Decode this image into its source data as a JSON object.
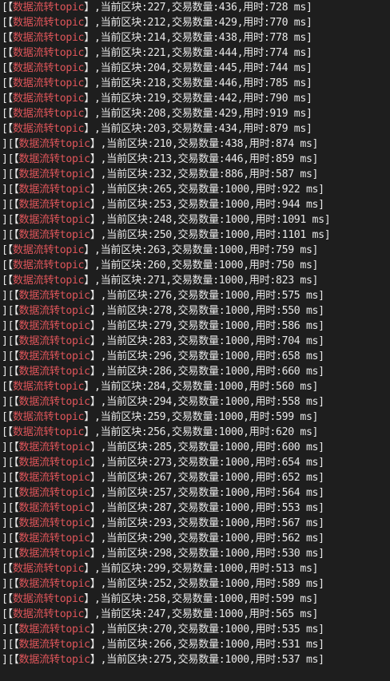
{
  "terminal": {
    "colors": {
      "background": "#1e1e1e",
      "text": "#e8e8e8",
      "topic": "#e0555a"
    },
    "lines": [
      {
        "prefix": "[【",
        "topic": "数据流转topic",
        "suffix": "】,当前区块:227,交易数量:436,用时:728 ms]"
      },
      {
        "prefix": "[【",
        "topic": "数据流转topic",
        "suffix": "】,当前区块:212,交易数量:429,用时:770 ms]"
      },
      {
        "prefix": "[【",
        "topic": "数据流转topic",
        "suffix": "】,当前区块:214,交易数量:438,用时:778 ms]"
      },
      {
        "prefix": "[【",
        "topic": "数据流转topic",
        "suffix": "】,当前区块:221,交易数量:444,用时:774 ms]"
      },
      {
        "prefix": "[【",
        "topic": "数据流转topic",
        "suffix": "】,当前区块:204,交易数量:445,用时:744 ms]"
      },
      {
        "prefix": "[【",
        "topic": "数据流转topic",
        "suffix": "】,当前区块:218,交易数量:446,用时:785 ms]"
      },
      {
        "prefix": "[【",
        "topic": "数据流转topic",
        "suffix": "】,当前区块:219,交易数量:442,用时:790 ms]"
      },
      {
        "prefix": "[【",
        "topic": "数据流转topic",
        "suffix": "】,当前区块:208,交易数量:429,用时:919 ms]"
      },
      {
        "prefix": "[【",
        "topic": "数据流转topic",
        "suffix": "】,当前区块:203,交易数量:434,用时:879 ms]"
      },
      {
        "prefix": "][【",
        "topic": "数据流转topic",
        "suffix": "】,当前区块:210,交易数量:438,用时:874 ms]"
      },
      {
        "prefix": "][【",
        "topic": "数据流转topic",
        "suffix": "】,当前区块:213,交易数量:446,用时:859 ms]"
      },
      {
        "prefix": "][【",
        "topic": "数据流转topic",
        "suffix": "】,当前区块:232,交易数量:886,用时:587 ms]"
      },
      {
        "prefix": "][【",
        "topic": "数据流转topic",
        "suffix": "】,当前区块:265,交易数量:1000,用时:922 ms]"
      },
      {
        "prefix": "][【",
        "topic": "数据流转topic",
        "suffix": "】,当前区块:253,交易数量:1000,用时:944 ms]"
      },
      {
        "prefix": "][【",
        "topic": "数据流转topic",
        "suffix": "】,当前区块:248,交易数量:1000,用时:1091 ms]"
      },
      {
        "prefix": "][【",
        "topic": "数据流转topic",
        "suffix": "】,当前区块:250,交易数量:1000,用时:1101 ms]"
      },
      {
        "prefix": "[【",
        "topic": "数据流转topic",
        "suffix": "】,当前区块:263,交易数量:1000,用时:759 ms]"
      },
      {
        "prefix": "[【",
        "topic": "数据流转topic",
        "suffix": "】,当前区块:260,交易数量:1000,用时:750 ms]"
      },
      {
        "prefix": "[【",
        "topic": "数据流转topic",
        "suffix": "】,当前区块:271,交易数量:1000,用时:823 ms]"
      },
      {
        "prefix": "][【",
        "topic": "数据流转topic",
        "suffix": "】,当前区块:276,交易数量:1000,用时:575 ms]"
      },
      {
        "prefix": "][【",
        "topic": "数据流转topic",
        "suffix": "】,当前区块:278,交易数量:1000,用时:550 ms]"
      },
      {
        "prefix": "][【",
        "topic": "数据流转topic",
        "suffix": "】,当前区块:279,交易数量:1000,用时:586 ms]"
      },
      {
        "prefix": "][【",
        "topic": "数据流转topic",
        "suffix": "】,当前区块:283,交易数量:1000,用时:704 ms]"
      },
      {
        "prefix": "][【",
        "topic": "数据流转topic",
        "suffix": "】,当前区块:296,交易数量:1000,用时:658 ms]"
      },
      {
        "prefix": "][【",
        "topic": "数据流转topic",
        "suffix": "】,当前区块:286,交易数量:1000,用时:660 ms]"
      },
      {
        "prefix": "[【",
        "topic": "数据流转topic",
        "suffix": "】,当前区块:284,交易数量:1000,用时:560 ms]"
      },
      {
        "prefix": "][【",
        "topic": "数据流转topic",
        "suffix": "】,当前区块:294,交易数量:1000,用时:558 ms]"
      },
      {
        "prefix": "[【",
        "topic": "数据流转topic",
        "suffix": "】,当前区块:259,交易数量:1000,用时:599 ms]"
      },
      {
        "prefix": "[【",
        "topic": "数据流转topic",
        "suffix": "】,当前区块:256,交易数量:1000,用时:620 ms]"
      },
      {
        "prefix": "][【",
        "topic": "数据流转topic",
        "suffix": "】,当前区块:285,交易数量:1000,用时:600 ms]"
      },
      {
        "prefix": "][【",
        "topic": "数据流转topic",
        "suffix": "】,当前区块:273,交易数量:1000,用时:654 ms]"
      },
      {
        "prefix": "][【",
        "topic": "数据流转topic",
        "suffix": "】,当前区块:267,交易数量:1000,用时:652 ms]"
      },
      {
        "prefix": "][【",
        "topic": "数据流转topic",
        "suffix": "】,当前区块:257,交易数量:1000,用时:564 ms]"
      },
      {
        "prefix": "][【",
        "topic": "数据流转topic",
        "suffix": "】,当前区块:287,交易数量:1000,用时:553 ms]"
      },
      {
        "prefix": "][【",
        "topic": "数据流转topic",
        "suffix": "】,当前区块:293,交易数量:1000,用时:567 ms]"
      },
      {
        "prefix": "][【",
        "topic": "数据流转topic",
        "suffix": "】,当前区块:290,交易数量:1000,用时:562 ms]"
      },
      {
        "prefix": "][【",
        "topic": "数据流转topic",
        "suffix": "】,当前区块:298,交易数量:1000,用时:530 ms]"
      },
      {
        "prefix": "[【",
        "topic": "数据流转topic",
        "suffix": "】,当前区块:299,交易数量:1000,用时:513 ms]"
      },
      {
        "prefix": "][【",
        "topic": "数据流转topic",
        "suffix": "】,当前区块:252,交易数量:1000,用时:589 ms]"
      },
      {
        "prefix": "[【",
        "topic": "数据流转topic",
        "suffix": "】,当前区块:258,交易数量:1000,用时:599 ms]"
      },
      {
        "prefix": "[【",
        "topic": "数据流转topic",
        "suffix": "】,当前区块:247,交易数量:1000,用时:565 ms]"
      },
      {
        "prefix": "][【",
        "topic": "数据流转topic",
        "suffix": "】,当前区块:270,交易数量:1000,用时:535 ms]"
      },
      {
        "prefix": "][【",
        "topic": "数据流转topic",
        "suffix": "】,当前区块:266,交易数量:1000,用时:531 ms]"
      },
      {
        "prefix": "][【",
        "topic": "数据流转topic",
        "suffix": "】,当前区块:275,交易数量:1000,用时:537 ms]"
      }
    ]
  }
}
